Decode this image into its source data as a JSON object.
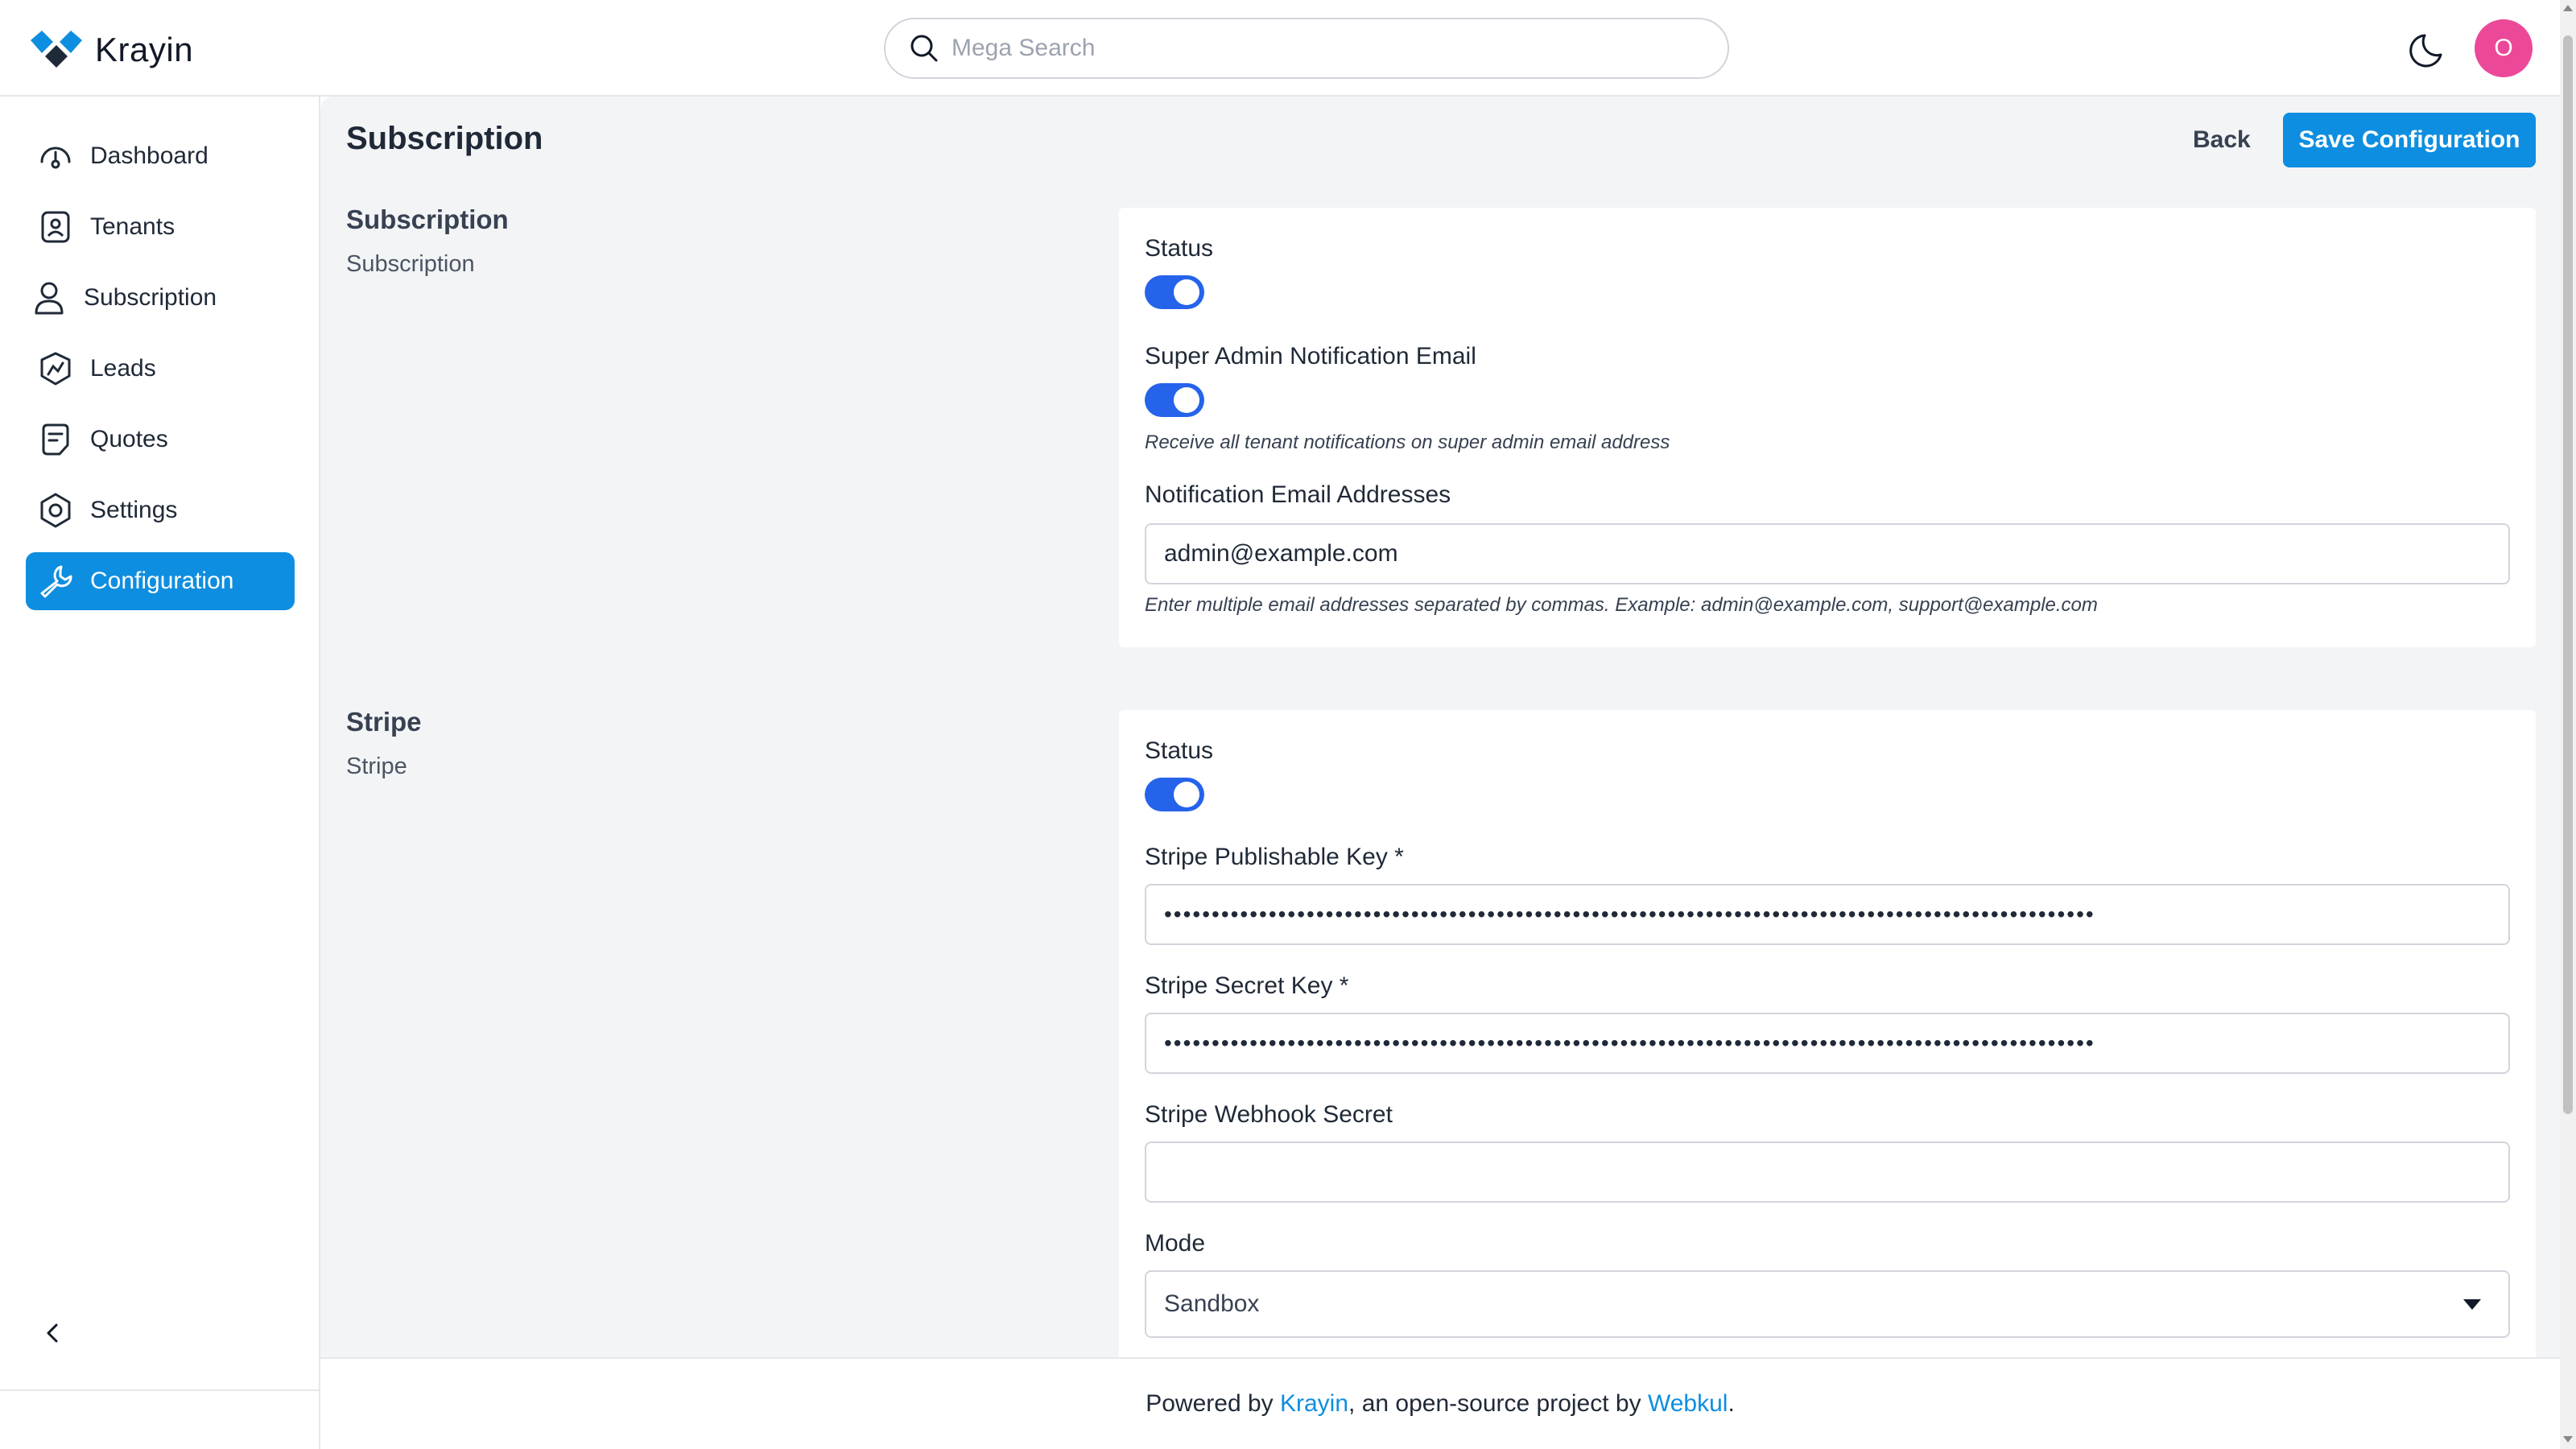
{
  "app": {
    "name": "Krayin",
    "avatar_initial": "O",
    "accent_color": "#0e8ee0",
    "avatar_color": "#ec4899",
    "toggle_color": "#2563eb"
  },
  "search": {
    "placeholder": "Mega Search"
  },
  "sidebar": {
    "items": [
      {
        "label": "Dashboard",
        "icon": "dashboard-icon"
      },
      {
        "label": "Tenants",
        "icon": "tenants-icon"
      },
      {
        "label": "Subscription",
        "icon": "user-icon"
      },
      {
        "label": "Leads",
        "icon": "leads-icon"
      },
      {
        "label": "Quotes",
        "icon": "quotes-icon"
      },
      {
        "label": "Settings",
        "icon": "settings-icon"
      },
      {
        "label": "Configuration",
        "icon": "wrench-icon",
        "active": true
      }
    ]
  },
  "page": {
    "title": "Subscription",
    "back_label": "Back",
    "save_label": "Save Configuration"
  },
  "subscription_section": {
    "title": "Subscription",
    "subtitle": "Subscription",
    "status_label": "Status",
    "status_enabled": true,
    "super_admin_label": "Super Admin Notification Email",
    "super_admin_enabled": true,
    "super_admin_hint": "Receive all tenant notifications on super admin email address",
    "emails_label": "Notification Email Addresses",
    "emails_value": "admin@example.com",
    "emails_hint": "Enter multiple email addresses separated by commas. Example: admin@example.com, support@example.com"
  },
  "stripe_section": {
    "title": "Stripe",
    "subtitle": "Stripe",
    "status_label": "Status",
    "status_enabled": true,
    "publishable_key_label": "Stripe Publishable Key *",
    "publishable_key_masked": "••••••••••••••••••••••••••••••••••••••••••••••••••••••••••••••••••••••••••••••••••••••••••••••••••",
    "secret_key_label": "Stripe Secret Key *",
    "secret_key_masked": "••••••••••••••••••••••••••••••••••••••••••••••••••••••••••••••••••••••••••••••••••••••••••••••••••",
    "webhook_label": "Stripe Webhook Secret",
    "webhook_value": "",
    "mode_label": "Mode",
    "mode_value": "Sandbox"
  },
  "footer": {
    "prefix": "Powered by ",
    "krayin_link": "Krayin",
    "middle": ", an open-source project by ",
    "webkul_link": "Webkul",
    "suffix": "."
  }
}
